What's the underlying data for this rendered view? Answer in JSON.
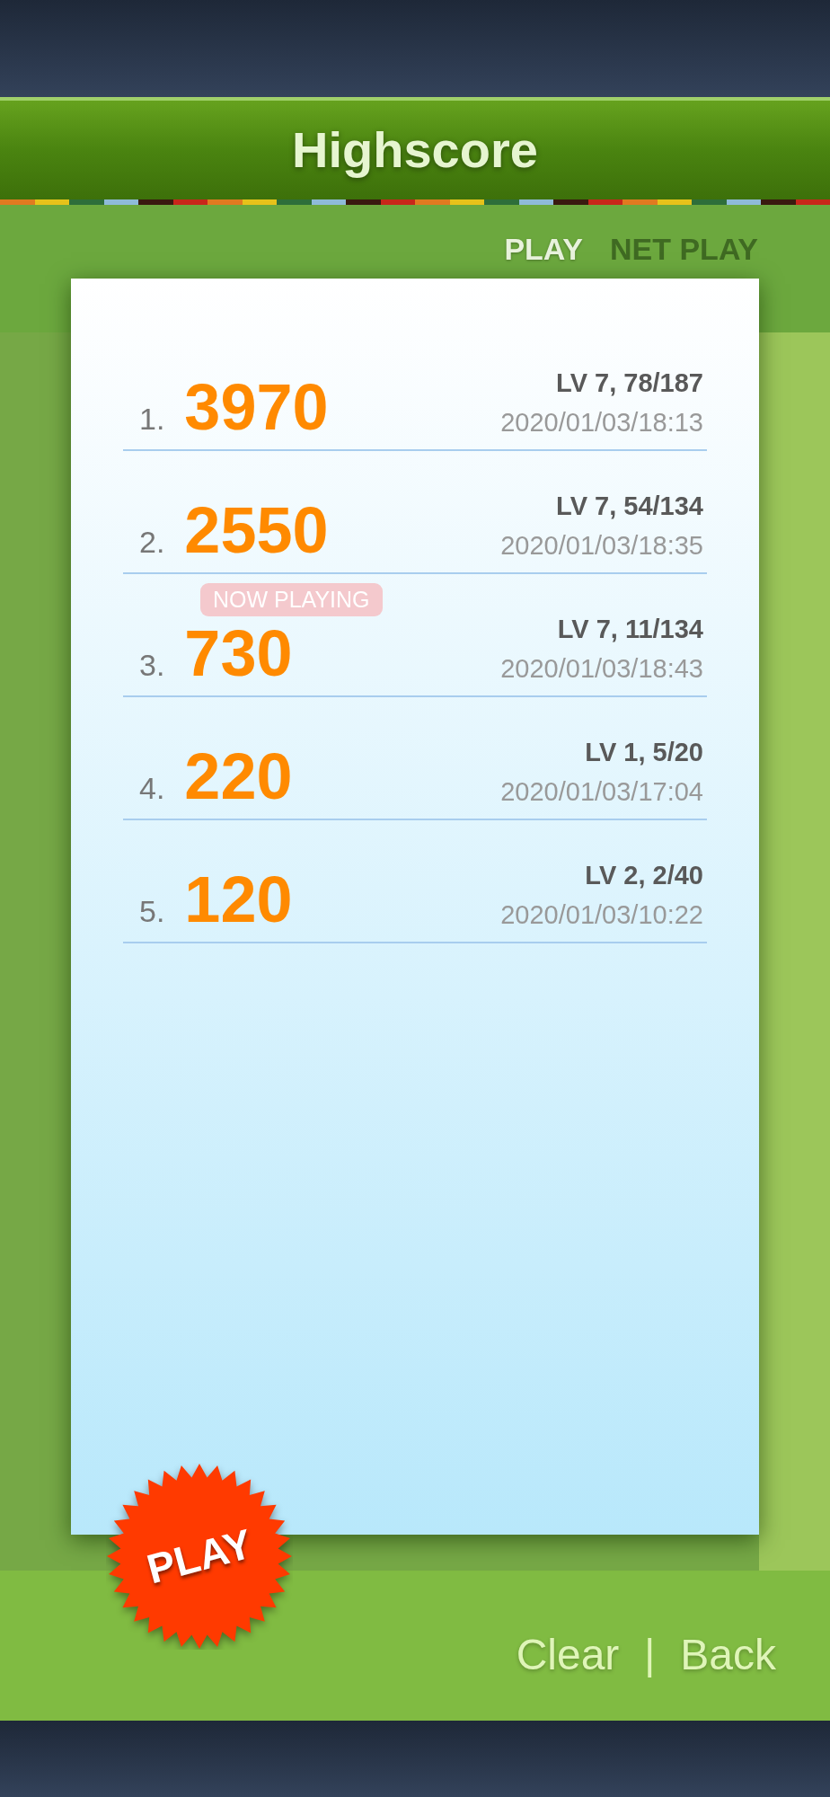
{
  "title": "Highscore",
  "tabs": [
    {
      "label": "PLAY",
      "selected": true
    },
    {
      "label": "NET PLAY",
      "selected": false
    }
  ],
  "rows": [
    {
      "rank": "1.",
      "score": "3970",
      "level": "LV 7, 78/187",
      "date": "2020/01/03/18:13"
    },
    {
      "rank": "2.",
      "score": "2550",
      "level": "LV 7, 54/134",
      "date": "2020/01/03/18:35"
    },
    {
      "rank": "3.",
      "score": "730",
      "level": "LV 7, 11/134",
      "date": "2020/01/03/18:43",
      "badge": "NOW PLAYING"
    },
    {
      "rank": "4.",
      "score": "220",
      "level": "LV 1, 5/20",
      "date": "2020/01/03/17:04"
    },
    {
      "rank": "5.",
      "score": "120",
      "level": "LV 2, 2/40",
      "date": "2020/01/03/10:22"
    }
  ],
  "play_button": "PLAY",
  "footer_links": [
    "Clear",
    "Back"
  ],
  "footer_separator": "|"
}
